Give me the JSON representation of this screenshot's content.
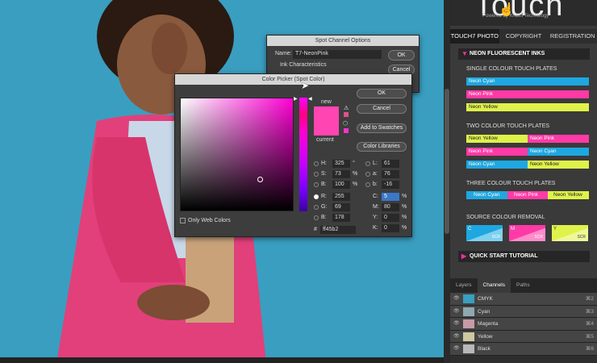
{
  "plugin": {
    "logo_text": "Touch",
    "logo_sub": "Powered by Khaos Technology",
    "tabs": [
      "TOUCH7 PHOTO",
      "COPYRIGHT",
      "REGISTRATION"
    ],
    "header": "NEON FLUORESCENT INKS",
    "single_title": "SINGLE COLOUR TOUCH PLATES",
    "single": [
      "Neon Cyan",
      "Neon Pink",
      "Neon Yellow"
    ],
    "two_title": "TWO COLOUR TOUCH PLATES",
    "two": [
      [
        "Neon Yellow",
        "Neon Pink"
      ],
      [
        "Neon Pink",
        "Neon Cyan"
      ],
      [
        "Neon Cyan",
        "Neon Yellow"
      ]
    ],
    "three_title": "THREE COLOUR TOUCH PLATES",
    "three": [
      "Neon Cyan",
      "Neon Pink",
      "Neon Yellow"
    ],
    "source_title": "SOURCE COLOUR REMOVAL",
    "source": [
      {
        "letter": "C",
        "scr": "SCR"
      },
      {
        "letter": "M",
        "scr": "SCR"
      },
      {
        "letter": "Y",
        "scr": "SCR"
      }
    ],
    "footer": "QUICK START TUTORIAL"
  },
  "layers_panel": {
    "tabs": [
      "Layers",
      "Channels",
      "Paths"
    ],
    "channels": [
      {
        "name": "CMYK",
        "key": "⌘2"
      },
      {
        "name": "Cyan",
        "key": "⌘3"
      },
      {
        "name": "Magenta",
        "key": "⌘4"
      },
      {
        "name": "Yellow",
        "key": "⌘5"
      },
      {
        "name": "Black",
        "key": "⌘6"
      }
    ]
  },
  "spot_dialog": {
    "title": "Spot Channel Options",
    "name_label": "Name:",
    "name_value": "T7-NeonPink",
    "ink_label": "Ink Characteristics",
    "ok": "OK",
    "cancel": "Cancel"
  },
  "picker": {
    "title": "Color Picker (Spot Color)",
    "ok": "OK",
    "cancel": "Cancel",
    "add_swatches": "Add to Swatches",
    "libraries": "Color Libraries",
    "new_label": "new",
    "current_label": "current",
    "only_web": "Only Web Colors",
    "hex_prefix": "#",
    "hex": "ff45b2",
    "new_color": "#ff45b2",
    "current_color": "#ff45b2",
    "hsb": [
      {
        "l": "H:",
        "v": "325",
        "u": "°"
      },
      {
        "l": "S:",
        "v": "73",
        "u": "%"
      },
      {
        "l": "B:",
        "v": "100",
        "u": "%"
      }
    ],
    "rgb": [
      {
        "l": "R:",
        "v": "255"
      },
      {
        "l": "G:",
        "v": "69"
      },
      {
        "l": "B:",
        "v": "178"
      }
    ],
    "lab": [
      {
        "l": "L:",
        "v": "61"
      },
      {
        "l": "a:",
        "v": "76"
      },
      {
        "l": "b:",
        "v": "-16"
      }
    ],
    "cmyk": [
      {
        "l": "C:",
        "v": "5",
        "u": "%"
      },
      {
        "l": "M:",
        "v": "80",
        "u": "%"
      },
      {
        "l": "Y:",
        "v": "0",
        "u": "%"
      },
      {
        "l": "K:",
        "v": "0",
        "u": "%"
      }
    ]
  },
  "colors": {
    "neon_cyan": "#1ea7e0",
    "neon_pink": "#ff3aa6",
    "neon_yellow": "#dff24a"
  }
}
